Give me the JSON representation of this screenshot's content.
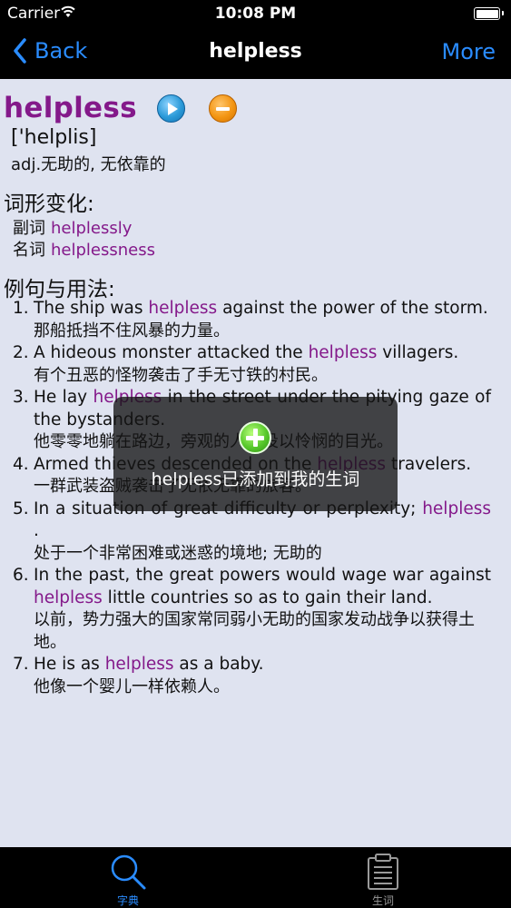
{
  "status_bar": {
    "carrier": "Carrier",
    "time": "10:08 PM",
    "battery_level": 1.0
  },
  "nav": {
    "back_label": "Back",
    "title": "helpless",
    "more_label": "More"
  },
  "entry": {
    "headword": "helpless",
    "phonetic": "['helplis]",
    "definition": "adj.无助的, 无依靠的",
    "forms_heading": "词形变化:",
    "forms": [
      {
        "kind": "副词",
        "word": "helplessly"
      },
      {
        "kind": "名词",
        "word": "helplessness"
      }
    ],
    "examples_heading": "例句与用法:",
    "examples": [
      {
        "num": "1.",
        "en_before": "The ship was ",
        "en_highlight": "helpless",
        "en_after": " against the power of the storm.",
        "zh": "那船抵挡不住风暴的力量。"
      },
      {
        "num": "2.",
        "en_before": "A hideous monster attacked the ",
        "en_highlight": "helpless",
        "en_after": " villagers.",
        "zh": "有个丑恶的怪物袭击了手无寸铁的村民。"
      },
      {
        "num": "3.",
        "en_before": "He lay ",
        "en_highlight": "helpless",
        "en_after": " in the street under the pitying gaze of the bystanders.",
        "zh": "他零零地躺在路边，旁观的人都投以怜悯的目光。"
      },
      {
        "num": "4.",
        "en_before": "Armed thieves descended on the ",
        "en_highlight": "helpless",
        "en_after": " travelers.",
        "zh": "一群武装盗贼袭击了无依无靠的旅客。"
      },
      {
        "num": "5.",
        "en_before": "In a situation of great difficulty or perplexity; ",
        "en_highlight": "helpless",
        "en_after": " .",
        "zh": "处于一个非常困难或迷惑的境地; 无助的"
      },
      {
        "num": "6.",
        "en_before": "In the past, the great powers would wage war against ",
        "en_highlight": "helpless",
        "en_after": " little countries so as to gain their land.",
        "zh": "以前，势力强大的国家常同弱小无助的国家发动战争以获得土地。"
      },
      {
        "num": "7.",
        "en_before": "He is as ",
        "en_highlight": "helpless",
        "en_after": " as a baby.",
        "zh": "他像一个婴儿一样依赖人。"
      }
    ]
  },
  "toast": {
    "message": "helpless已添加到我的生词"
  },
  "tabbar": {
    "tabs": [
      {
        "label": "字典",
        "icon": "search-icon",
        "active": true
      },
      {
        "label": "生词",
        "icon": "clipboard-icon",
        "active": false
      }
    ]
  },
  "colors": {
    "accent": "#2a8cff",
    "highlight": "#84198a",
    "background": "#dfe3f0"
  }
}
